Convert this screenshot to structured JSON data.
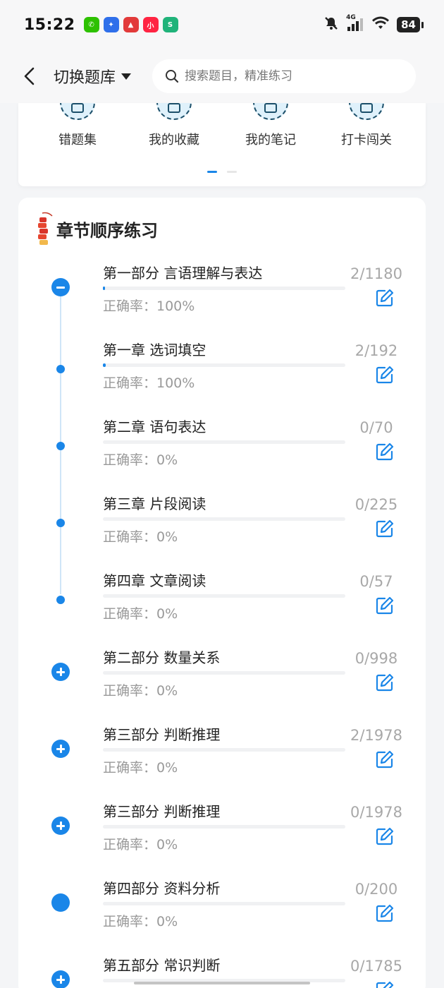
{
  "status_bar": {
    "time": "15:22",
    "network": "4G",
    "battery": "84",
    "app_icons": [
      {
        "name": "wechat-icon",
        "color": "#2dc100",
        "glyph": "✆"
      },
      {
        "name": "app-blue-icon",
        "color": "#2f6fea",
        "glyph": "✦"
      },
      {
        "name": "app-red-triangle-icon",
        "color": "#e23a3a",
        "glyph": "▲"
      },
      {
        "name": "xiaohongshu-icon",
        "color": "#ff2442",
        "glyph": "小"
      },
      {
        "name": "app-green-icon",
        "color": "#20b37a",
        "glyph": "S"
      }
    ]
  },
  "header": {
    "switch_bank_label": "切换题库",
    "search_placeholder": "搜索题目，精准练习"
  },
  "quick_entries": [
    {
      "label": "错题集",
      "icon": "wrong-questions-icon"
    },
    {
      "label": "我的收藏",
      "icon": "favorites-icon"
    },
    {
      "label": "我的笔记",
      "icon": "notes-icon"
    },
    {
      "label": "打卡闯关",
      "icon": "check-in-icon"
    }
  ],
  "section": {
    "title": "章节顺序练习"
  },
  "chapters": [
    {
      "title": "第一部分 言语理解与表达",
      "accuracy": "正确率：100%",
      "count": "2/1180",
      "node": "minus",
      "progress": 0.0017
    },
    {
      "title": "第一章 选词填空",
      "accuracy": "正确率：100%",
      "count": "2/192",
      "node": "dot",
      "progress": 0.0104
    },
    {
      "title": "第二章 语句表达",
      "accuracy": "正确率：0%",
      "count": "0/70",
      "node": "dot",
      "progress": 0
    },
    {
      "title": "第三章 片段阅读",
      "accuracy": "正确率：0%",
      "count": "0/225",
      "node": "dot",
      "progress": 0
    },
    {
      "title": "第四章 文章阅读",
      "accuracy": "正确率：0%",
      "count": "0/57",
      "node": "dot",
      "progress": 0
    },
    {
      "title": "第二部分 数量关系",
      "accuracy": "正确率：0%",
      "count": "0/998",
      "node": "plus",
      "progress": 0
    },
    {
      "title": "第三部分 判断推理",
      "accuracy": "正确率：0%",
      "count": "2/1978",
      "node": "plus",
      "progress": 0
    },
    {
      "title": "第三部分 判断推理",
      "accuracy": "正确率：0%",
      "count": "0/1978",
      "node": "plus",
      "progress": 0
    },
    {
      "title": "第四部分 资料分析",
      "accuracy": "正确率：0%",
      "count": "0/200",
      "node": "solid",
      "progress": 0
    },
    {
      "title": "第五部分 常识判断",
      "accuracy": "正确率：0%",
      "count": "0/1785",
      "node": "plus",
      "progress": 0
    }
  ],
  "colors": {
    "accent": "#1a86e8",
    "muted_text": "#999999",
    "count_text": "#a8a8a8"
  }
}
